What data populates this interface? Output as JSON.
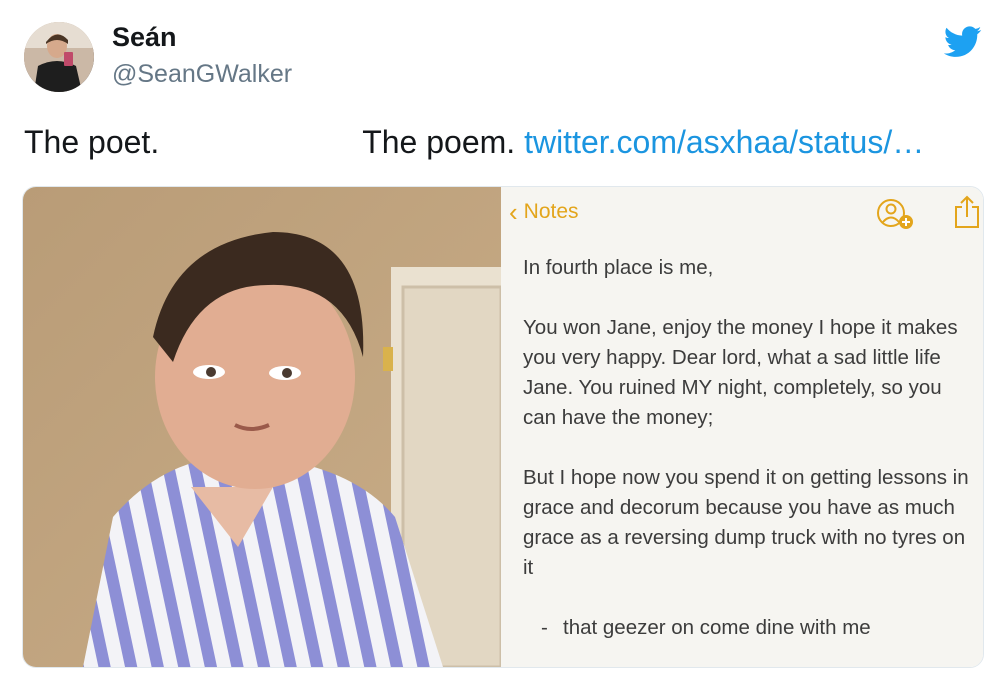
{
  "tweet": {
    "display_name": "Seán",
    "handle": "@SeanGWalker",
    "text_left": "The poet.",
    "text_right": "The poem.",
    "link": "twitter.com/asxhaa/status/…",
    "bird_icon": "twitter-bird-icon",
    "brand_color": "#1da1f2"
  },
  "notes": {
    "back_label": "Notes",
    "accent_color": "#e3a51c",
    "icons": [
      "add-contact-icon",
      "share-icon"
    ],
    "lines": {
      "p1": "In fourth place is me,",
      "p2": "You won Jane, enjoy the money I hope it makes you very happy. Dear lord, what a sad little life Jane. You ruined MY night, completely, so you can have the money;",
      "p3": "But I hope now you spend it on getting lessons in grace and decorum because you have as much grace as a reversing dump truck with no tyres on it",
      "sig": "that geezer on come dine with me"
    }
  }
}
